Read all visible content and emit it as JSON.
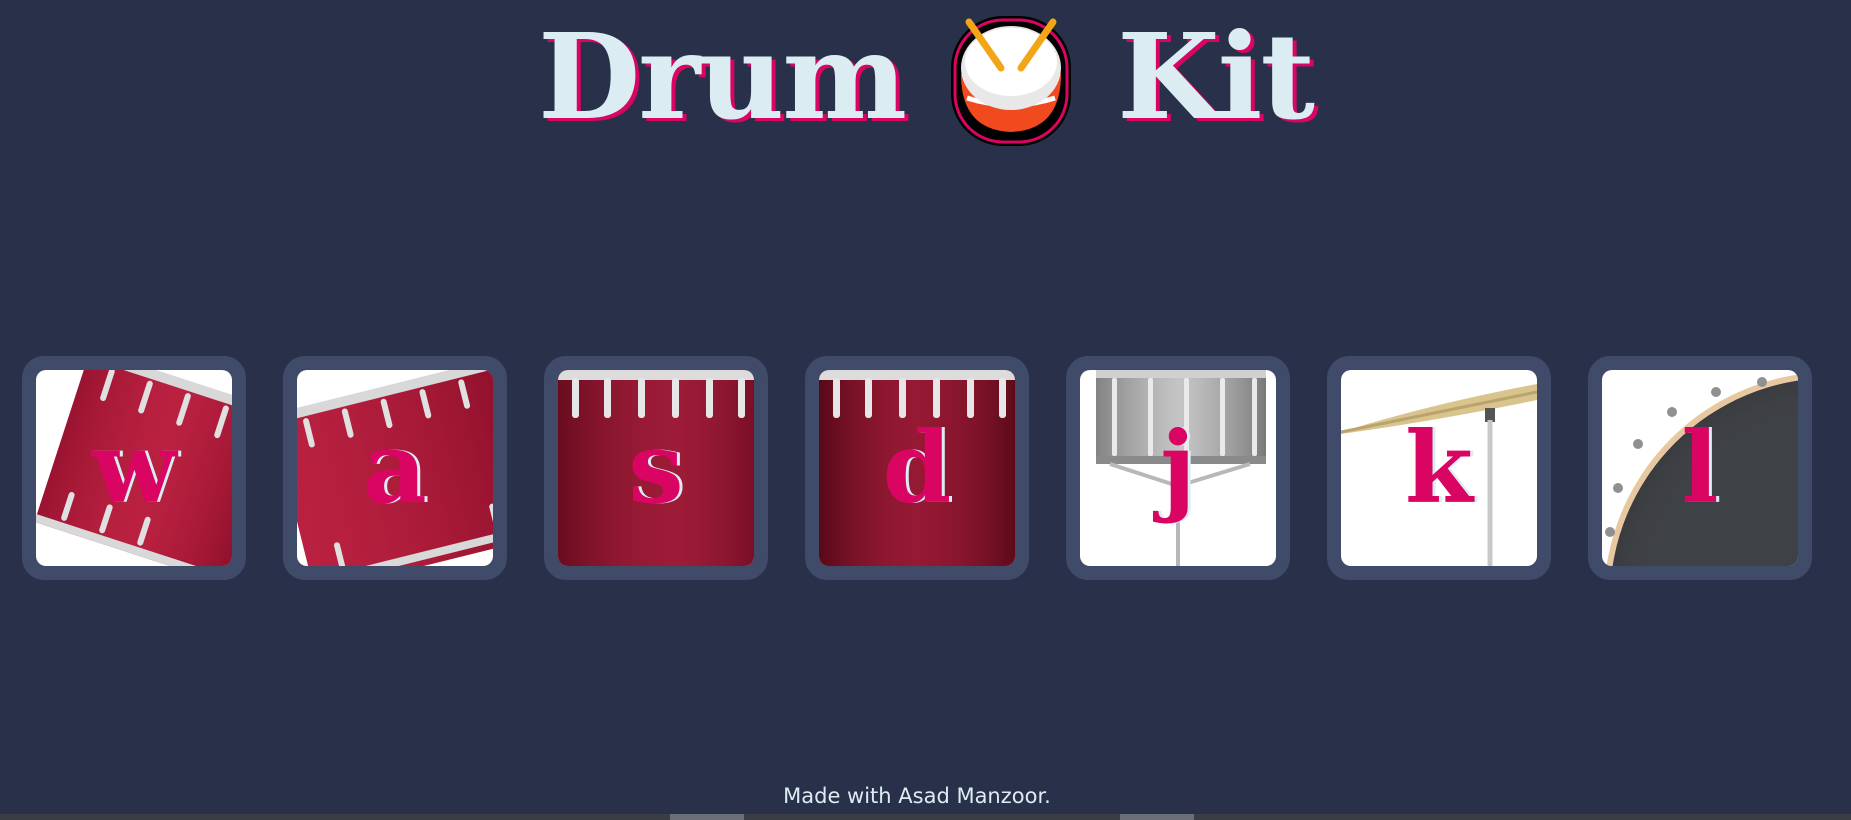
{
  "header": {
    "word_left": "Drum",
    "word_right": "Kit",
    "emoji_icon": "drum-emoji-icon"
  },
  "drums": [
    {
      "key": "w",
      "icon": "tom-drum-tilted-icon"
    },
    {
      "key": "a",
      "icon": "tom-drum-tilted-icon"
    },
    {
      "key": "s",
      "icon": "bass-drum-side-icon"
    },
    {
      "key": "d",
      "icon": "bass-drum-side-icon"
    },
    {
      "key": "j",
      "icon": "snare-drum-icon"
    },
    {
      "key": "k",
      "icon": "crash-cymbal-icon"
    },
    {
      "key": "l",
      "icon": "kick-drum-icon"
    }
  ],
  "footer": {
    "text": "Made with Asad Manzoor."
  },
  "colors": {
    "background": "#283149",
    "button": "#404b69",
    "accent": "#da0463",
    "text": "#dbedf3"
  }
}
